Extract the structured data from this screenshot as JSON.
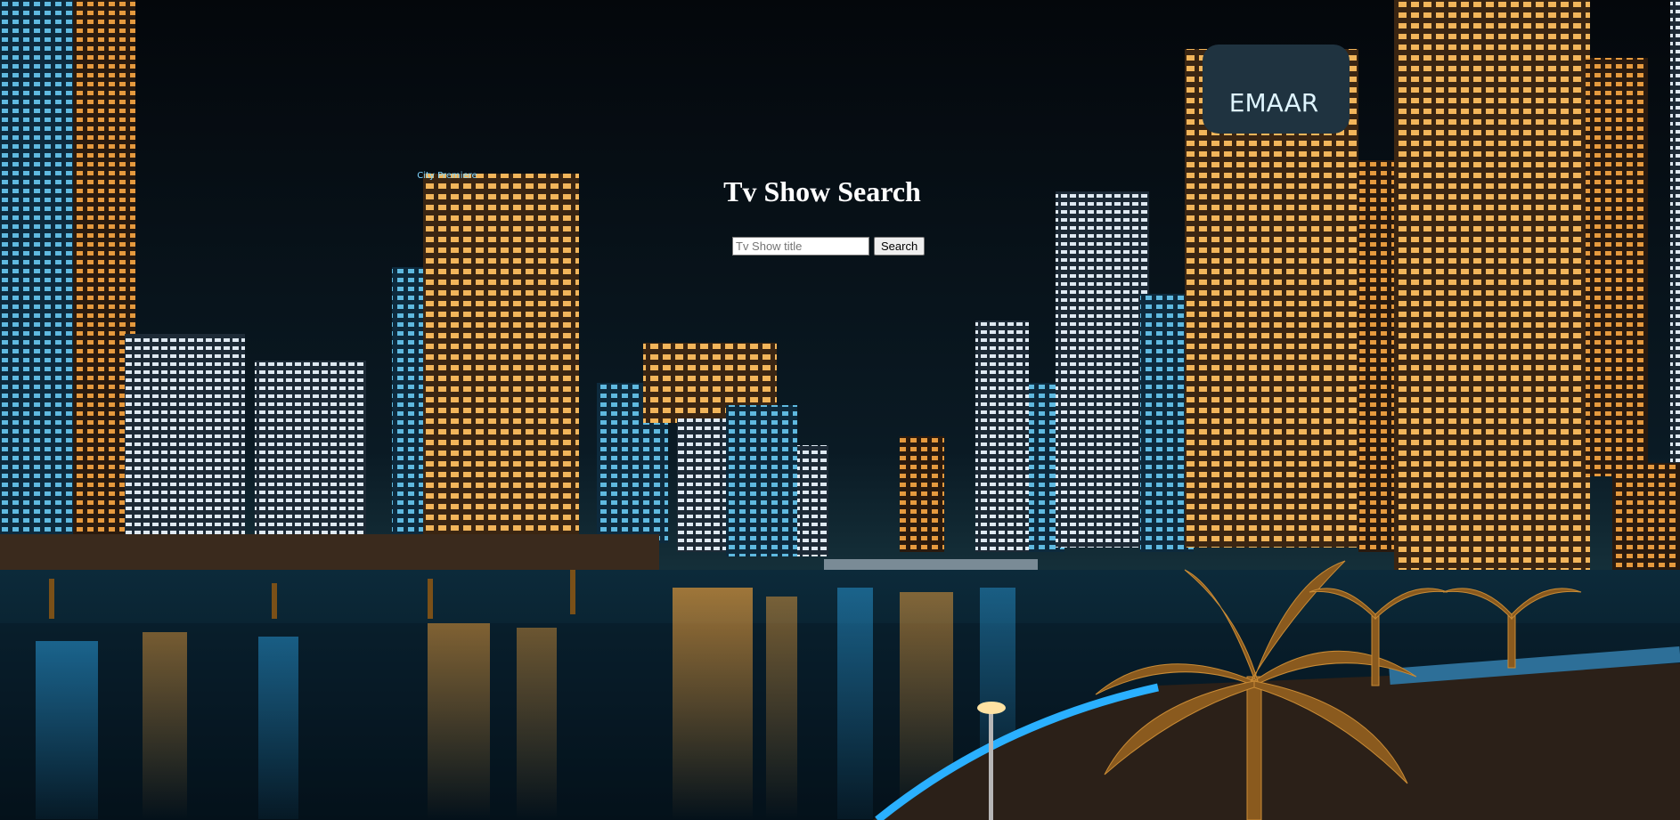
{
  "heading": {
    "title": "Tv Show Search"
  },
  "search": {
    "placeholder": "Tv Show title",
    "value": "",
    "button_label": "Search"
  },
  "background": {
    "signs": {
      "emaar": "EMAAR",
      "city_premiere": "City Premiere"
    }
  }
}
